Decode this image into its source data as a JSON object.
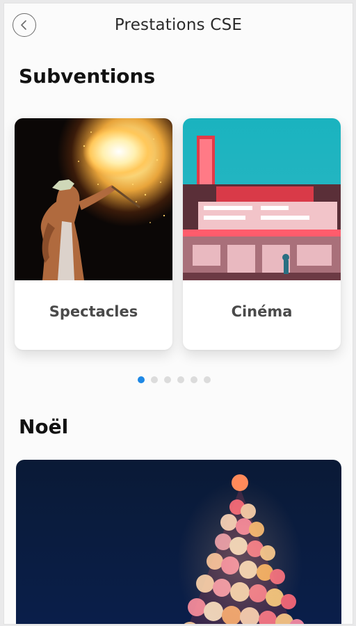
{
  "header": {
    "title": "Prestations CSE",
    "back_icon": "chevron-left-icon"
  },
  "subventions": {
    "title": "Subventions",
    "cards": [
      {
        "label": "Spectacles",
        "image": "fire-breather-photo"
      },
      {
        "label": "Cinéma",
        "image": "cinema-marquee-photo"
      }
    ],
    "pagination": {
      "total": 6,
      "active": 1
    }
  },
  "noel": {
    "title": "Noël",
    "image": "christmas-tree-bokeh-photo"
  },
  "colors": {
    "accent": "#1e88e5",
    "dot_inactive": "#dcdcdc",
    "background": "#fbfbfb"
  }
}
